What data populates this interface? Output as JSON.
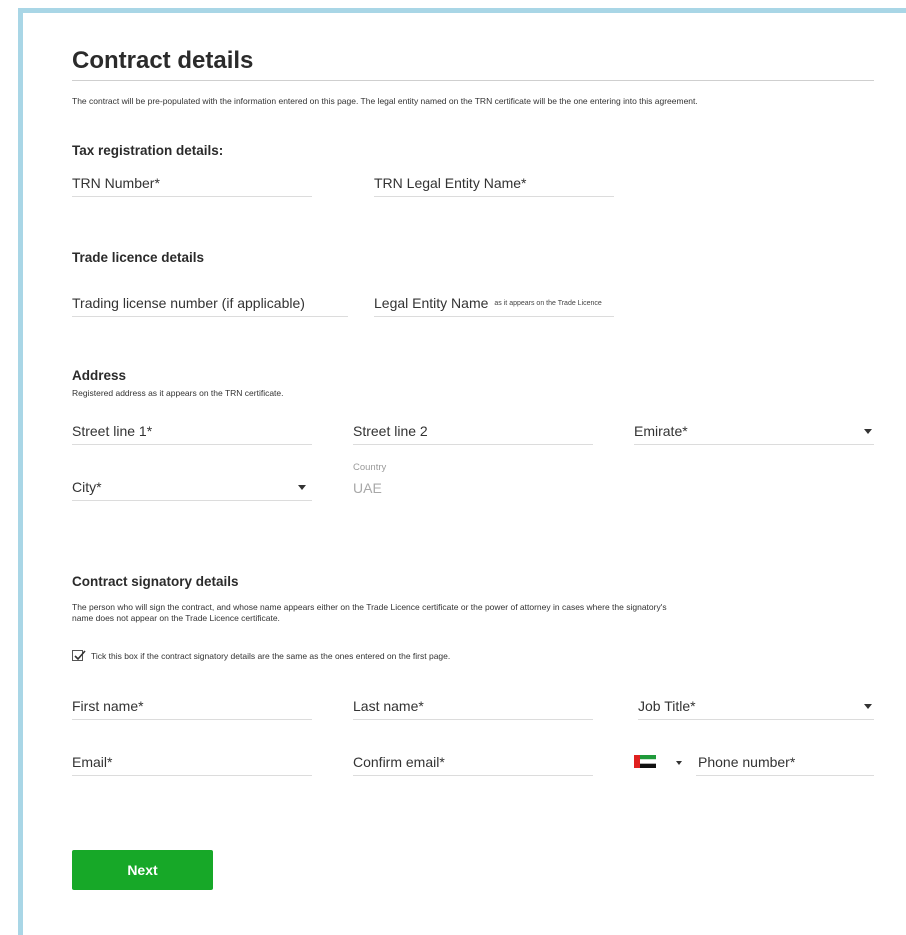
{
  "page": {
    "title": "Contract details",
    "intro": "The contract will be pre-populated with the information entered on this page. The legal entity named on the TRN certificate will be the one entering into this agreement."
  },
  "tax": {
    "heading": "Tax registration details:",
    "trn_number_label": "TRN Number*",
    "trn_entity_label": "TRN Legal Entity Name*"
  },
  "trade": {
    "heading": "Trade licence details",
    "license_number_label": "Trading license number (if applicable)",
    "legal_entity_label": "Legal Entity Name",
    "legal_entity_hint": "as it appears on the Trade Licence"
  },
  "address": {
    "heading": "Address",
    "subtext": "Registered address as it appears on the TRN certificate.",
    "street1_label": "Street line 1*",
    "street2_label": "Street line 2",
    "emirate_label": "Emirate*",
    "city_label": "City*",
    "country_caption": "Country",
    "country_value": "UAE"
  },
  "signatory": {
    "heading": "Contract signatory details",
    "subtext": "The person who will sign the contract, and whose name appears either on the Trade Licence certificate or the power of attorney in cases where the signatory's name does not appear on the Trade Licence certificate.",
    "same_as_first_page_label": "Tick this box if the contract signatory details are the same as the ones entered on the first page.",
    "same_as_first_page_checked": true,
    "first_name_label": "First name*",
    "last_name_label": "Last name*",
    "job_title_label": "Job Title*",
    "email_label": "Email*",
    "confirm_email_label": "Confirm email*",
    "phone_label": "Phone number*",
    "phone_country_icon": "uae-flag-icon"
  },
  "actions": {
    "next_label": "Next",
    "next_color": "#17a828"
  },
  "colors": {
    "frame_border": "#a9d6e6"
  }
}
